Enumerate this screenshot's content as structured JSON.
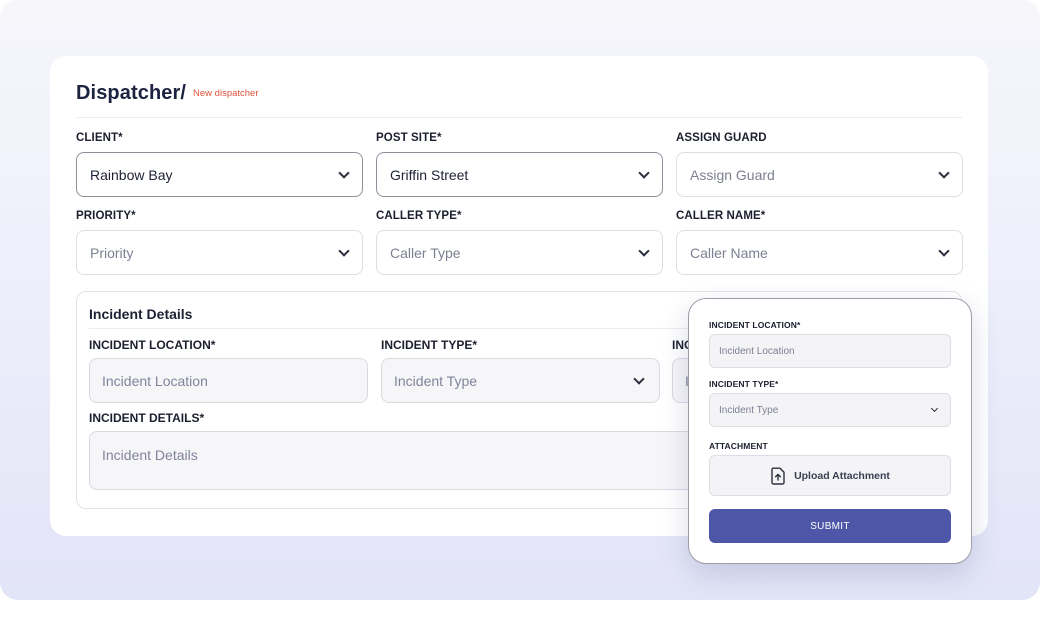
{
  "header": {
    "title": "Dispatcher/",
    "breadcrumb": "New dispatcher"
  },
  "form": {
    "client": {
      "label": "CLIENT*",
      "value": "Rainbow Bay"
    },
    "post_site": {
      "label": "POST SITE*",
      "value": "Griffin Street"
    },
    "assign_guard": {
      "label": "ASSIGN GUARD",
      "placeholder": "Assign Guard"
    },
    "priority": {
      "label": "PRIORITY*",
      "placeholder": "Priority"
    },
    "caller_type": {
      "label": "CALLER TYPE*",
      "placeholder": "Caller Type"
    },
    "caller_name": {
      "label": "CALLER NAME*",
      "placeholder": "Caller Name"
    }
  },
  "incident": {
    "title": "Incident Details",
    "location": {
      "label": "INCIDENT LOCATION*",
      "placeholder": "Incident Location"
    },
    "type": {
      "label": "INCIDENT TYPE*",
      "placeholder": "Incident Type"
    },
    "third_label_partial": "INC",
    "third_input_partial": "I",
    "details": {
      "label": "INCIDENT DETAILS*",
      "placeholder": "Incident Details"
    }
  },
  "popup": {
    "location": {
      "label": "INCIDENT LOCATION*",
      "placeholder": "Incident Location"
    },
    "type": {
      "label": "INCIDENT TYPE*",
      "placeholder": "Incident Type"
    },
    "attachment": {
      "label": "ATTACHMENT",
      "button": "Upload Attachment"
    },
    "submit": "SUBMIT"
  },
  "colors": {
    "accent": "#4e57a7",
    "breadcrumb": "#e0533d",
    "title": "#1c2340"
  },
  "icons": {
    "dropdown": "chevron-down-icon",
    "upload": "file-upload-icon"
  }
}
